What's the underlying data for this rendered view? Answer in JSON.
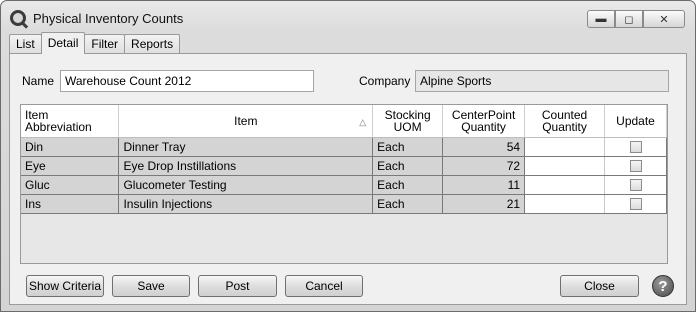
{
  "window": {
    "title": "Physical Inventory Counts"
  },
  "tabs": [
    {
      "label": "List"
    },
    {
      "label": "Detail"
    },
    {
      "label": "Filter"
    },
    {
      "label": "Reports"
    }
  ],
  "form": {
    "name_label": "Name",
    "name_value": "Warehouse Count 2012",
    "company_label": "Company",
    "company_value": "Alpine Sports"
  },
  "grid": {
    "headers": {
      "abbr": "Item Abbreviation",
      "item": "Item",
      "uom_l1": "Stocking",
      "uom_l2": "UOM",
      "cpq_l1": "CenterPoint",
      "cpq_l2": "Quantity",
      "cq_l1": "Counted",
      "cq_l2": "Quantity",
      "update": "Update"
    },
    "rows": [
      {
        "abbr": "Din",
        "item": "Dinner Tray",
        "uom": "Each",
        "cpq": "54",
        "counted": ""
      },
      {
        "abbr": "Eye",
        "item": "Eye Drop Instillations",
        "uom": "Each",
        "cpq": "72",
        "counted": ""
      },
      {
        "abbr": "Gluc",
        "item": "Glucometer Testing",
        "uom": "Each",
        "cpq": "11",
        "counted": ""
      },
      {
        "abbr": "Ins",
        "item": "Insulin Injections",
        "uom": "Each",
        "cpq": "21",
        "counted": ""
      }
    ]
  },
  "buttons": {
    "show_criteria": "Show Criteria",
    "save": "Save",
    "post": "Post",
    "cancel": "Cancel",
    "close": "Close",
    "help": "?"
  }
}
